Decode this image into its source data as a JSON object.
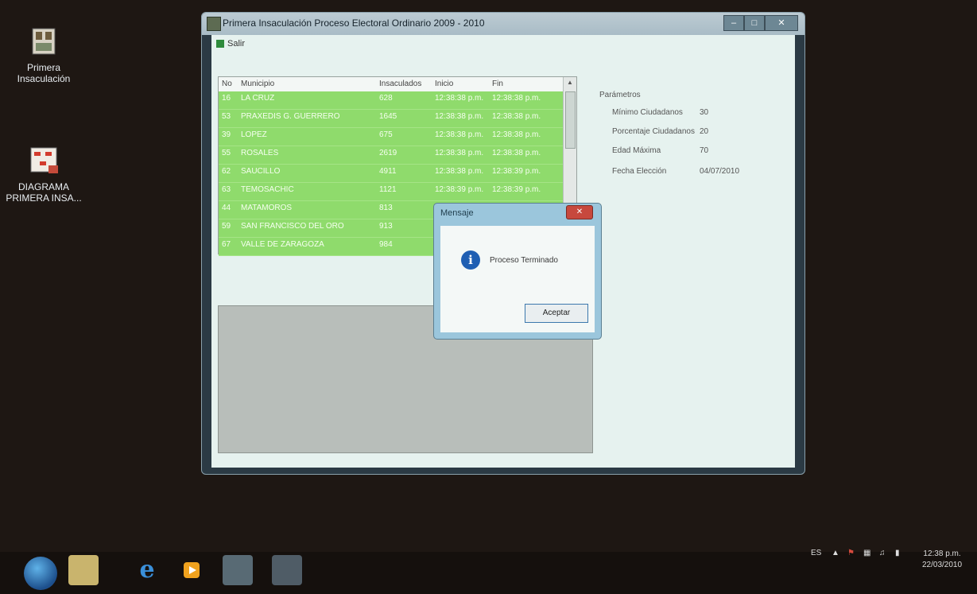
{
  "desktop": {
    "icons": [
      {
        "label_line1": "Primera",
        "label_line2": "Insaculación",
        "icon": "app-building-icon"
      },
      {
        "label_line1": "DIAGRAMA",
        "label_line2": "PRIMERA INSA...",
        "icon": "diagram-icon"
      }
    ]
  },
  "window": {
    "title": "Primera Insaculación Proceso Electoral Ordinario 2009 - 2010",
    "menu": {
      "exit_label": "Salir"
    },
    "grid": {
      "columns": [
        "No",
        "Municipio",
        "Insaculados",
        "Inicio",
        "Fin"
      ],
      "rows": [
        {
          "no": "16",
          "municipio": "LA CRUZ",
          "insaculados": "628",
          "inicio": "12:38:38 p.m.",
          "fin": "12:38:38 p.m."
        },
        {
          "no": "53",
          "municipio": "PRAXEDIS G. GUERRERO",
          "insaculados": "1645",
          "inicio": "12:38:38 p.m.",
          "fin": "12:38:38 p.m."
        },
        {
          "no": "39",
          "municipio": "LOPEZ",
          "insaculados": "675",
          "inicio": "12:38:38 p.m.",
          "fin": "12:38:38 p.m."
        },
        {
          "no": "55",
          "municipio": "ROSALES",
          "insaculados": "2619",
          "inicio": "12:38:38 p.m.",
          "fin": "12:38:38 p.m."
        },
        {
          "no": "62",
          "municipio": "SAUCILLO",
          "insaculados": "4911",
          "inicio": "12:38:38 p.m.",
          "fin": "12:38:39 p.m."
        },
        {
          "no": "63",
          "municipio": "TEMOSACHIC",
          "insaculados": "1121",
          "inicio": "12:38:39 p.m.",
          "fin": "12:38:39 p.m."
        },
        {
          "no": "44",
          "municipio": "MATAMOROS",
          "insaculados": "813",
          "inicio": "",
          "fin": ""
        },
        {
          "no": "59",
          "municipio": "SAN FRANCISCO DEL ORO",
          "insaculados": "913",
          "inicio": "",
          "fin": ""
        },
        {
          "no": "67",
          "municipio": "VALLE DE ZARAGOZA",
          "insaculados": "984",
          "inicio": "",
          "fin": ""
        }
      ]
    },
    "params": {
      "heading": "Parámetros",
      "items": [
        {
          "label": "Mínimo Ciudadanos",
          "value": "30"
        },
        {
          "label": "Porcentaje Ciudadanos",
          "value": "20"
        },
        {
          "label": "Edad Máxima",
          "value": "70"
        },
        {
          "label": "Fecha Elección",
          "value": "04/07/2010"
        }
      ]
    }
  },
  "dialog": {
    "title": "Mensaje",
    "message": "Proceso Terminado",
    "ok_label": "Aceptar"
  },
  "taskbar": {
    "apps": [
      "start-orb-icon",
      "file-explorer-icon",
      "internet-explorer-icon",
      "media-player-icon",
      "tools-app-icon",
      "insaculacion-app-icon"
    ],
    "tray": {
      "language": "ES",
      "time": "12:38 p.m.",
      "date": "22/03/2010"
    }
  },
  "colors": {
    "row_green": "#8fdb6c",
    "client_bg": "#e6f2ef",
    "dialog_frame": "#9bc6dc"
  }
}
